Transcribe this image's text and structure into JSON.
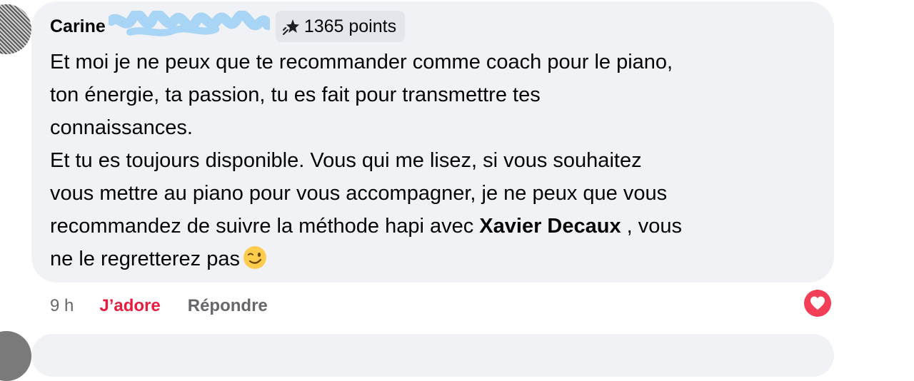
{
  "comment": {
    "author_first": "Carine",
    "points_label": "1365 points",
    "lines": [
      "Et moi je ne peux que te recommander comme coach pour le piano,",
      "ton énergie, ta passion, tu es fait pour transmettre tes",
      "connaissances.",
      "Et tu es toujours disponible. Vous qui me lisez, si vous souhaitez",
      "vous mettre au piano pour vous accompagner, je ne peux que vous"
    ],
    "line6_before": "recommandez de suivre la méthode hapi avec ",
    "mention": "Xavier Decaux",
    "line6_after": " , vous",
    "line7": "ne le regretterez pas",
    "emoji": "winking-face"
  },
  "actions": {
    "timestamp": "9 h",
    "like_label": "J’adore",
    "reply_label": "Répondre"
  },
  "reaction": {
    "icon": "heart-reaction-icon",
    "color": "#f33e58"
  },
  "colors": {
    "bubble": "#f0f2f5",
    "like_active": "#e41e3f",
    "muted": "#65676b",
    "redaction": "#a8d4f5"
  }
}
